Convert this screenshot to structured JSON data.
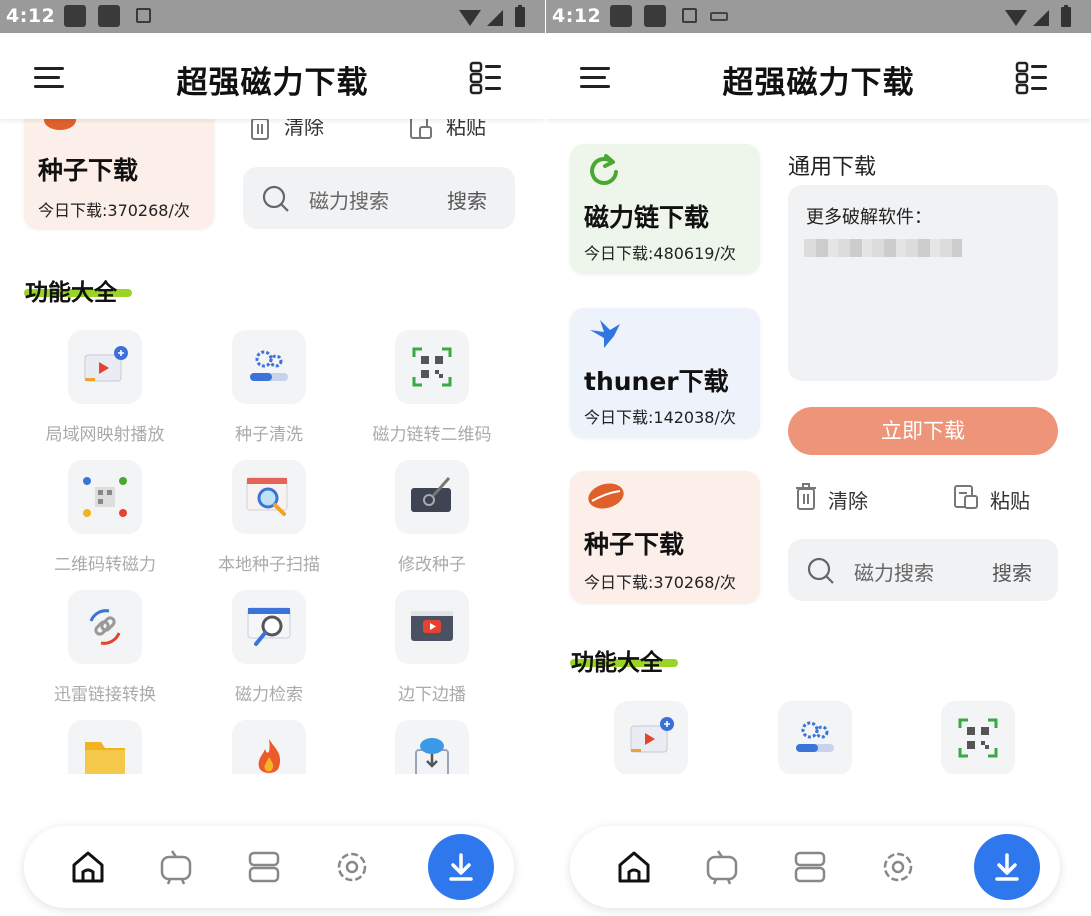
{
  "status": {
    "time": "4:12"
  },
  "app": {
    "title": "超强磁力下载"
  },
  "cards": {
    "magnet": {
      "title": "磁力链下载",
      "stat": "今日下载:480619/次"
    },
    "thunder": {
      "title": "thuner下载",
      "stat": "今日下载:142038/次"
    },
    "seed": {
      "title": "种子下载",
      "stat": "今日下载:370268/次"
    }
  },
  "general": {
    "title": "通用下载",
    "input_text": "更多破解软件：",
    "download_button": "立即下载",
    "clear_label": "清除",
    "paste_label": "粘贴",
    "search_placeholder": "磁力搜索",
    "search_button": "搜索"
  },
  "features": {
    "title": "功能大全",
    "items": [
      {
        "label": "局域网映射播放",
        "icon": "cast-play-icon"
      },
      {
        "label": "种子清洗",
        "icon": "gears-icon"
      },
      {
        "label": "磁力链转二维码",
        "icon": "qr-code-icon"
      },
      {
        "label": "二维码转磁力",
        "icon": "qr-convert-icon"
      },
      {
        "label": "本地种子扫描",
        "icon": "search-scan-icon"
      },
      {
        "label": "修改种子",
        "icon": "edit-tablet-icon"
      },
      {
        "label": "迅雷链接转换",
        "icon": "link-convert-icon"
      },
      {
        "label": "磁力检索",
        "icon": "magnet-search-icon"
      },
      {
        "label": "边下边播",
        "icon": "video-play-icon"
      },
      {
        "label": "",
        "icon": "folder-icon"
      },
      {
        "label": "",
        "icon": "fire-icon"
      },
      {
        "label": "",
        "icon": "cloud-download-icon"
      }
    ]
  },
  "nav": {
    "items": [
      "home-icon",
      "tv-icon",
      "layers-icon",
      "settings-icon"
    ],
    "fab_icon": "download-arrow-icon"
  },
  "colors": {
    "magnet_bg": "#eef6ec",
    "thunder_bg": "#eef2fb",
    "seed_bg": "#fcefe9",
    "accent_orange": "#ed9479",
    "fab_blue": "#2f77ec",
    "underline_green": "#9ad425"
  }
}
